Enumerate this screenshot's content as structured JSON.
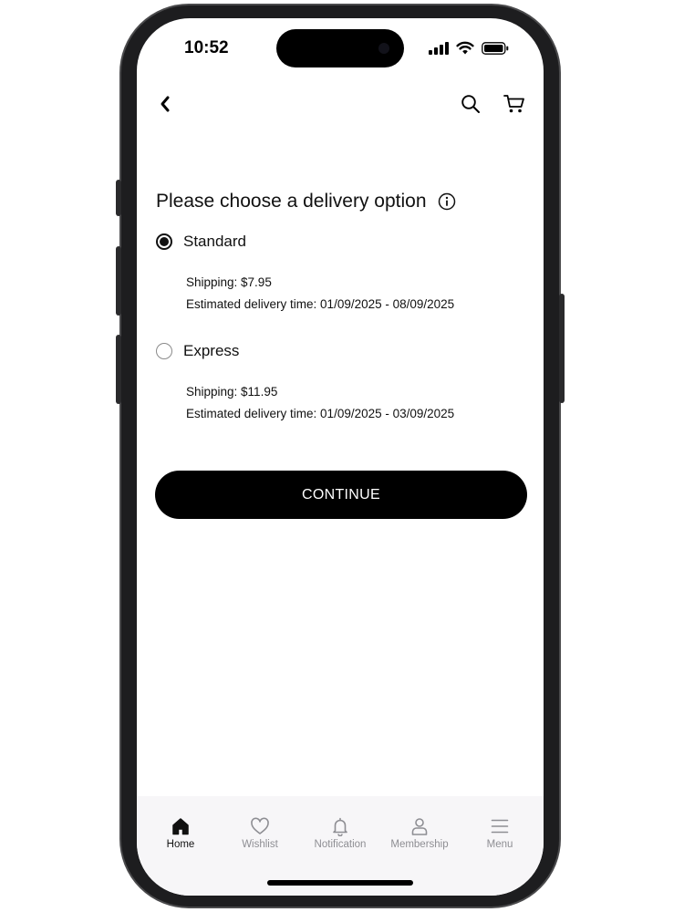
{
  "status_bar": {
    "time": "10:52",
    "icons": [
      "cellular-signal-icon",
      "wifi-icon",
      "battery-icon"
    ]
  },
  "top_bar": {
    "back_icon": "chevron-left-icon",
    "search_icon": "search-icon",
    "cart_icon": "cart-icon"
  },
  "delivery": {
    "heading": "Please choose a delivery option",
    "info_icon": "info-icon",
    "options": [
      {
        "label": "Standard",
        "selected": true,
        "shipping": "Shipping: $7.95",
        "estimate": "Estimated delivery time: 01/09/2025 - 08/09/2025"
      },
      {
        "label": "Express",
        "selected": false,
        "shipping": "Shipping: $11.95",
        "estimate": "Estimated delivery time: 01/09/2025 - 03/09/2025"
      }
    ],
    "continue_label": "CONTINUE"
  },
  "tab_bar": {
    "items": [
      {
        "label": "Home",
        "icon": "home-icon",
        "active": true
      },
      {
        "label": "Wishlist",
        "icon": "heart-icon",
        "active": false
      },
      {
        "label": "Notification",
        "icon": "bell-icon",
        "active": false
      },
      {
        "label": "Membership",
        "icon": "person-icon",
        "active": false
      },
      {
        "label": "Menu",
        "icon": "hamburger-menu-icon",
        "active": false
      }
    ]
  },
  "colors": {
    "primary": "#000000",
    "background": "#ffffff",
    "tab_bar_background": "#f7f6f8",
    "inactive_tab": "#8e8e93"
  }
}
